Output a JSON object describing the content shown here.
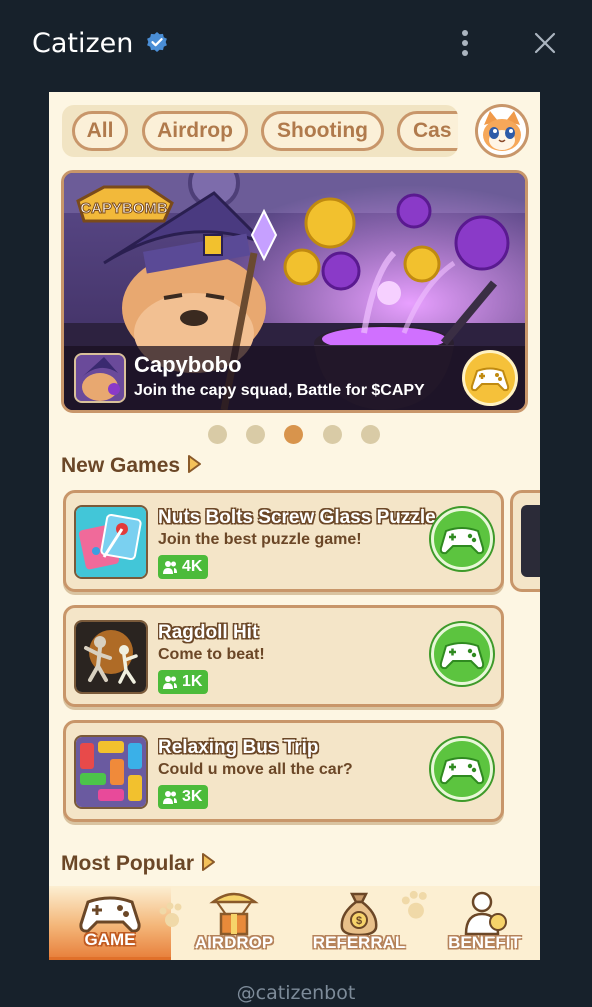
{
  "window": {
    "title": "Catizen",
    "verified_icon": "verified-check-icon",
    "menu_icon": "more-vertical-icon",
    "close_icon": "close-icon"
  },
  "filters": {
    "chips": [
      "All",
      "Airdrop",
      "Shooting",
      "Cas"
    ]
  },
  "banner": {
    "logo_text": "CAPYBOMB",
    "title": "Capybobo",
    "subtitle": "Join the capy squad, Battle for $CAPY",
    "carousel_active_index": 2,
    "carousel_count": 5
  },
  "new_games": {
    "title": "New Games",
    "items": [
      {
        "title": "Nuts Bolts Screw Glass Puzzle",
        "subtitle": "Join the best puzzle game!",
        "players": "4K",
        "icon": "puzzle-game-icon"
      },
      {
        "title": "Ragdoll Hit",
        "subtitle": "Come to beat!",
        "players": "1K",
        "icon": "ragdoll-game-icon"
      },
      {
        "title": "Relaxing Bus Trip",
        "subtitle": "Could u move all the car?",
        "players": "3K",
        "icon": "bus-game-icon"
      }
    ]
  },
  "most_popular": {
    "title": "Most Popular"
  },
  "nav": {
    "items": [
      {
        "label": "GAME",
        "icon": "gamepad-icon",
        "active": true
      },
      {
        "label": "AIRDROP",
        "icon": "airdrop-gift-icon",
        "active": false
      },
      {
        "label": "REFERRAL",
        "icon": "money-bag-icon",
        "active": false
      },
      {
        "label": "BENEFIT",
        "icon": "benefit-person-icon",
        "active": false
      }
    ]
  },
  "footer": {
    "handle": "@catizenbot"
  },
  "colors": {
    "background": "#17212b",
    "webview_bg": "#fdf6e3",
    "accent_brown": "#c8966a",
    "play_green": "#5cc43f",
    "active_tab": "#e8823e"
  }
}
